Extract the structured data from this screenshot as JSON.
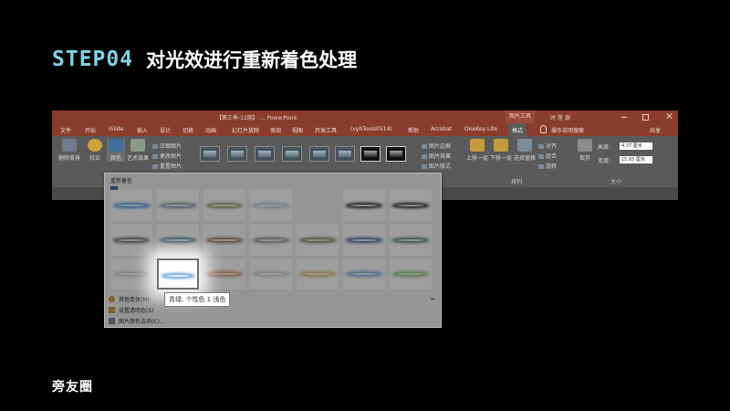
{
  "slide": {
    "step": "STEP04",
    "title": "对光效进行重新着色处理",
    "logo": "旁友圈"
  },
  "window": {
    "doc_title": "【第三季-12期】 ... PowerPoint",
    "context_tab": "图片工具",
    "user": "时 莲 源"
  },
  "tabs": [
    {
      "label": "文件"
    },
    {
      "label": "开始"
    },
    {
      "label": "iSlide"
    },
    {
      "label": "插入"
    },
    {
      "label": "设计"
    },
    {
      "label": "切换"
    },
    {
      "label": "动画"
    },
    {
      "label": "幻灯片放映"
    },
    {
      "label": "审阅"
    },
    {
      "label": "视图"
    },
    {
      "label": "开发工具"
    },
    {
      "label": "(vyhTools0514)"
    },
    {
      "label": "帮助"
    },
    {
      "label": "Acrobat"
    },
    {
      "label": "OneKey Lite"
    },
    {
      "label": "格式"
    },
    {
      "label": "操作说明搜索"
    },
    {
      "label": "共享"
    }
  ],
  "ribbon": {
    "remove_bg": "删除背景",
    "correct": "校正",
    "color": "颜色",
    "art": "艺术效果",
    "compress": "压缩图片",
    "change": "更改图片",
    "reset": "重置图片",
    "border": "图片边框",
    "effects": "图片效果",
    "layout": "图片版式",
    "forward": "上移一层",
    "backward": "下移一层",
    "selection": "选择窗格",
    "align": "对齐",
    "group": "组合",
    "rotate": "旋转",
    "crop": "裁剪",
    "height_label": "高度:",
    "height_value": "4.37 厘米",
    "width_label": "宽度:",
    "width_value": "15.65 厘米",
    "arrange_label": "排列",
    "size_label": "大小"
  },
  "recolor": {
    "header": "重新着色",
    "tooltip": "青绿, 个性色 1 浅色",
    "more_colors": "其他变体(M)",
    "set_transparent": "设置透明色(S)",
    "color_options": "图片颜色选项(C)...",
    "swatch_colors": [
      [
        "#4a90e2",
        "#7a8fa6",
        "#8a8f6a",
        "#b6c8d8",
        "#222222",
        "#202020"
      ],
      [
        "#5a5a5a",
        "#3a7090",
        "#8a6a55",
        "#8a8a8a",
        "#7a7a55",
        "#3a5a8a",
        "#4a7a5a"
      ],
      [
        "#cfcfcf",
        "#5a9ad8",
        "#d08a66",
        "#cacaca",
        "#d8c070",
        "#7aa0d8",
        "#8abf7a"
      ]
    ],
    "selected": "青绿, 个性色 1 浅色"
  }
}
